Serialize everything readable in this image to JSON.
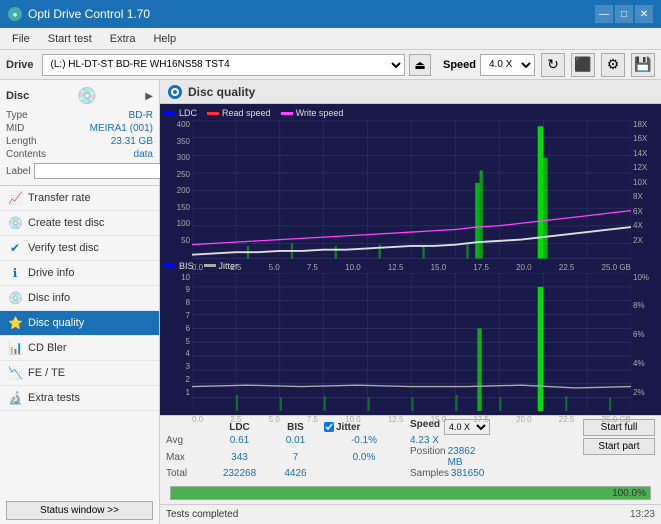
{
  "app": {
    "title": "Opti Drive Control 1.70",
    "icon": "disc-icon"
  },
  "titlebar": {
    "title": "Opti Drive Control 1.70",
    "minimize": "—",
    "maximize": "□",
    "close": "✕"
  },
  "menubar": {
    "items": [
      "File",
      "Start test",
      "Extra",
      "Help"
    ]
  },
  "drive_toolbar": {
    "drive_label": "Drive",
    "drive_value": "(L:)  HL-DT-ST BD-RE  WH16NS58 TST4",
    "speed_label": "Speed",
    "speed_value": "4.0 X"
  },
  "sidebar": {
    "disc_title": "Disc",
    "disc_fields": [
      {
        "label": "Type",
        "value": "BD-R"
      },
      {
        "label": "MID",
        "value": "MEIRA1 (001)"
      },
      {
        "label": "Length",
        "value": "23.31 GB"
      },
      {
        "label": "Contents",
        "value": "data"
      }
    ],
    "disc_label": "Label",
    "nav_items": [
      {
        "label": "Transfer rate",
        "icon": "📈"
      },
      {
        "label": "Create test disc",
        "icon": "💿"
      },
      {
        "label": "Verify test disc",
        "icon": "✔"
      },
      {
        "label": "Drive info",
        "icon": "ℹ"
      },
      {
        "label": "Disc info",
        "icon": "💿"
      },
      {
        "label": "Disc quality",
        "icon": "⭐",
        "active": true
      },
      {
        "label": "CD Bler",
        "icon": "📊"
      },
      {
        "label": "FE / TE",
        "icon": "📉"
      },
      {
        "label": "Extra tests",
        "icon": "🔬"
      }
    ],
    "status_btn": "Status window >>"
  },
  "content": {
    "title": "Disc quality"
  },
  "chart_top": {
    "legend": [
      {
        "label": "LDC",
        "color": "#0000ff"
      },
      {
        "label": "Read speed",
        "color": "#ff2222"
      },
      {
        "label": "Write speed",
        "color": "#ff44ff"
      }
    ],
    "y_max": 400,
    "y_labels_left": [
      "400",
      "350",
      "300",
      "250",
      "200",
      "150",
      "100",
      "50"
    ],
    "y_labels_right": [
      "18X",
      "16X",
      "14X",
      "12X",
      "10X",
      "8X",
      "6X",
      "4X",
      "2X"
    ],
    "x_labels": [
      "0.0",
      "2.5",
      "5.0",
      "7.5",
      "10.0",
      "12.5",
      "15.0",
      "17.5",
      "20.0",
      "22.5",
      "25.0 GB"
    ]
  },
  "chart_bottom": {
    "legend": [
      {
        "label": "BIS",
        "color": "#0000ff"
      },
      {
        "label": "Jitter",
        "color": "#aaaaaa"
      }
    ],
    "y_max": 10,
    "y_labels_left": [
      "10",
      "9",
      "8",
      "7",
      "6",
      "5",
      "4",
      "3",
      "2",
      "1"
    ],
    "y_labels_right": [
      "10%",
      "8%",
      "6%",
      "4%",
      "2%"
    ],
    "x_labels": [
      "0.0",
      "2.5",
      "5.0",
      "7.5",
      "10.0",
      "12.5",
      "15.0",
      "17.5",
      "20.0",
      "22.5",
      "25.0 GB"
    ]
  },
  "stats": {
    "columns": [
      "",
      "LDC",
      "BIS",
      "",
      "Jitter",
      "Speed",
      ""
    ],
    "rows": [
      {
        "label": "Avg",
        "ldc": "0.61",
        "bis": "0.01",
        "jitter": "-0.1%",
        "speed": "4.23 X"
      },
      {
        "label": "Max",
        "ldc": "343",
        "bis": "7",
        "jitter": "0.0%",
        "position": "23862 MB"
      },
      {
        "label": "Total",
        "ldc": "232268",
        "bis": "4426",
        "samples": "381650"
      }
    ],
    "jitter_checkbox": true,
    "jitter_label": "Jitter",
    "speed_display": "4.0 X",
    "speed_label": "Speed",
    "position_label": "Position",
    "samples_label": "Samples",
    "start_full": "Start full",
    "start_part": "Start part"
  },
  "progress": {
    "value": 100,
    "label": "100.0%"
  },
  "statusbar": {
    "text": "Tests completed",
    "time": "13:23"
  }
}
